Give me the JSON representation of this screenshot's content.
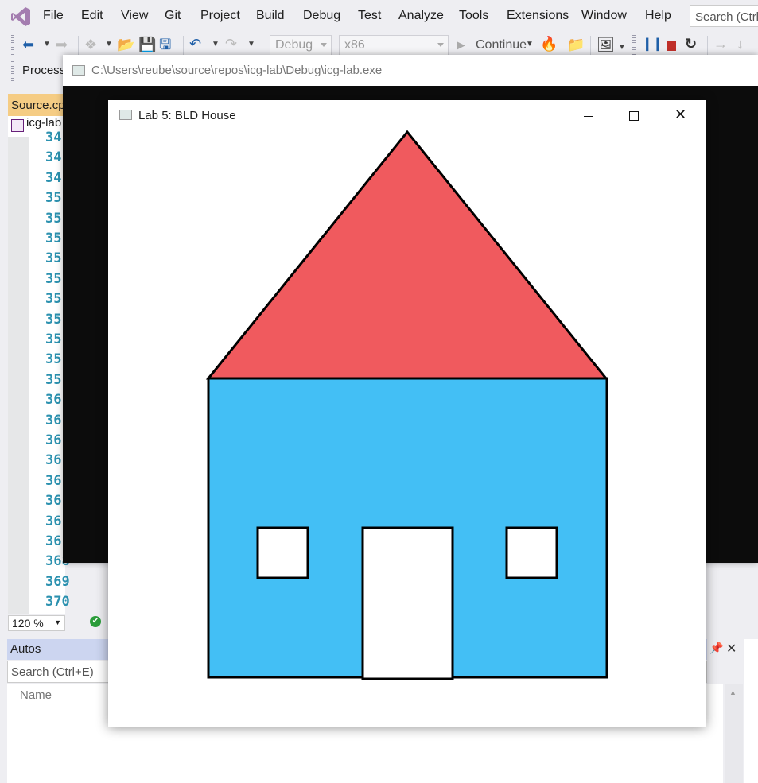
{
  "menu": {
    "items": [
      "File",
      "Edit",
      "View",
      "Git",
      "Project",
      "Build",
      "Debug",
      "Test",
      "Analyze",
      "Tools",
      "Extensions",
      "Window",
      "Help"
    ],
    "search_placeholder": "Search (Ctrl+Q)"
  },
  "toolbar": {
    "config_combo": "Debug",
    "platform_combo": "x86",
    "continue_label": "Continue"
  },
  "row3": {
    "process_label": "Process:"
  },
  "editor": {
    "tab_label": "Source.cpp",
    "file_label": "icg-lab",
    "line_numbers": [
      "34",
      "34",
      "34",
      "35",
      "35",
      "35",
      "35",
      "35",
      "35",
      "35",
      "35",
      "35",
      "35",
      "36",
      "36",
      "36",
      "36",
      "36",
      "36",
      "36",
      "36",
      "368",
      "369",
      "370"
    ],
    "zoom": "120 %"
  },
  "console": {
    "title": "C:\\Users\\reube\\source\\repos\\icg-lab\\Debug\\icg-lab.exe"
  },
  "gl_window": {
    "title": "Lab 5: BLD House"
  },
  "colors": {
    "roof": "#f05a5e",
    "walls": "#43bff5",
    "outline": "#000000",
    "window_fill": "#ffffff"
  },
  "autos": {
    "title": "Autos",
    "search_placeholder": "Search (Ctrl+E)",
    "column_name": "Name"
  }
}
